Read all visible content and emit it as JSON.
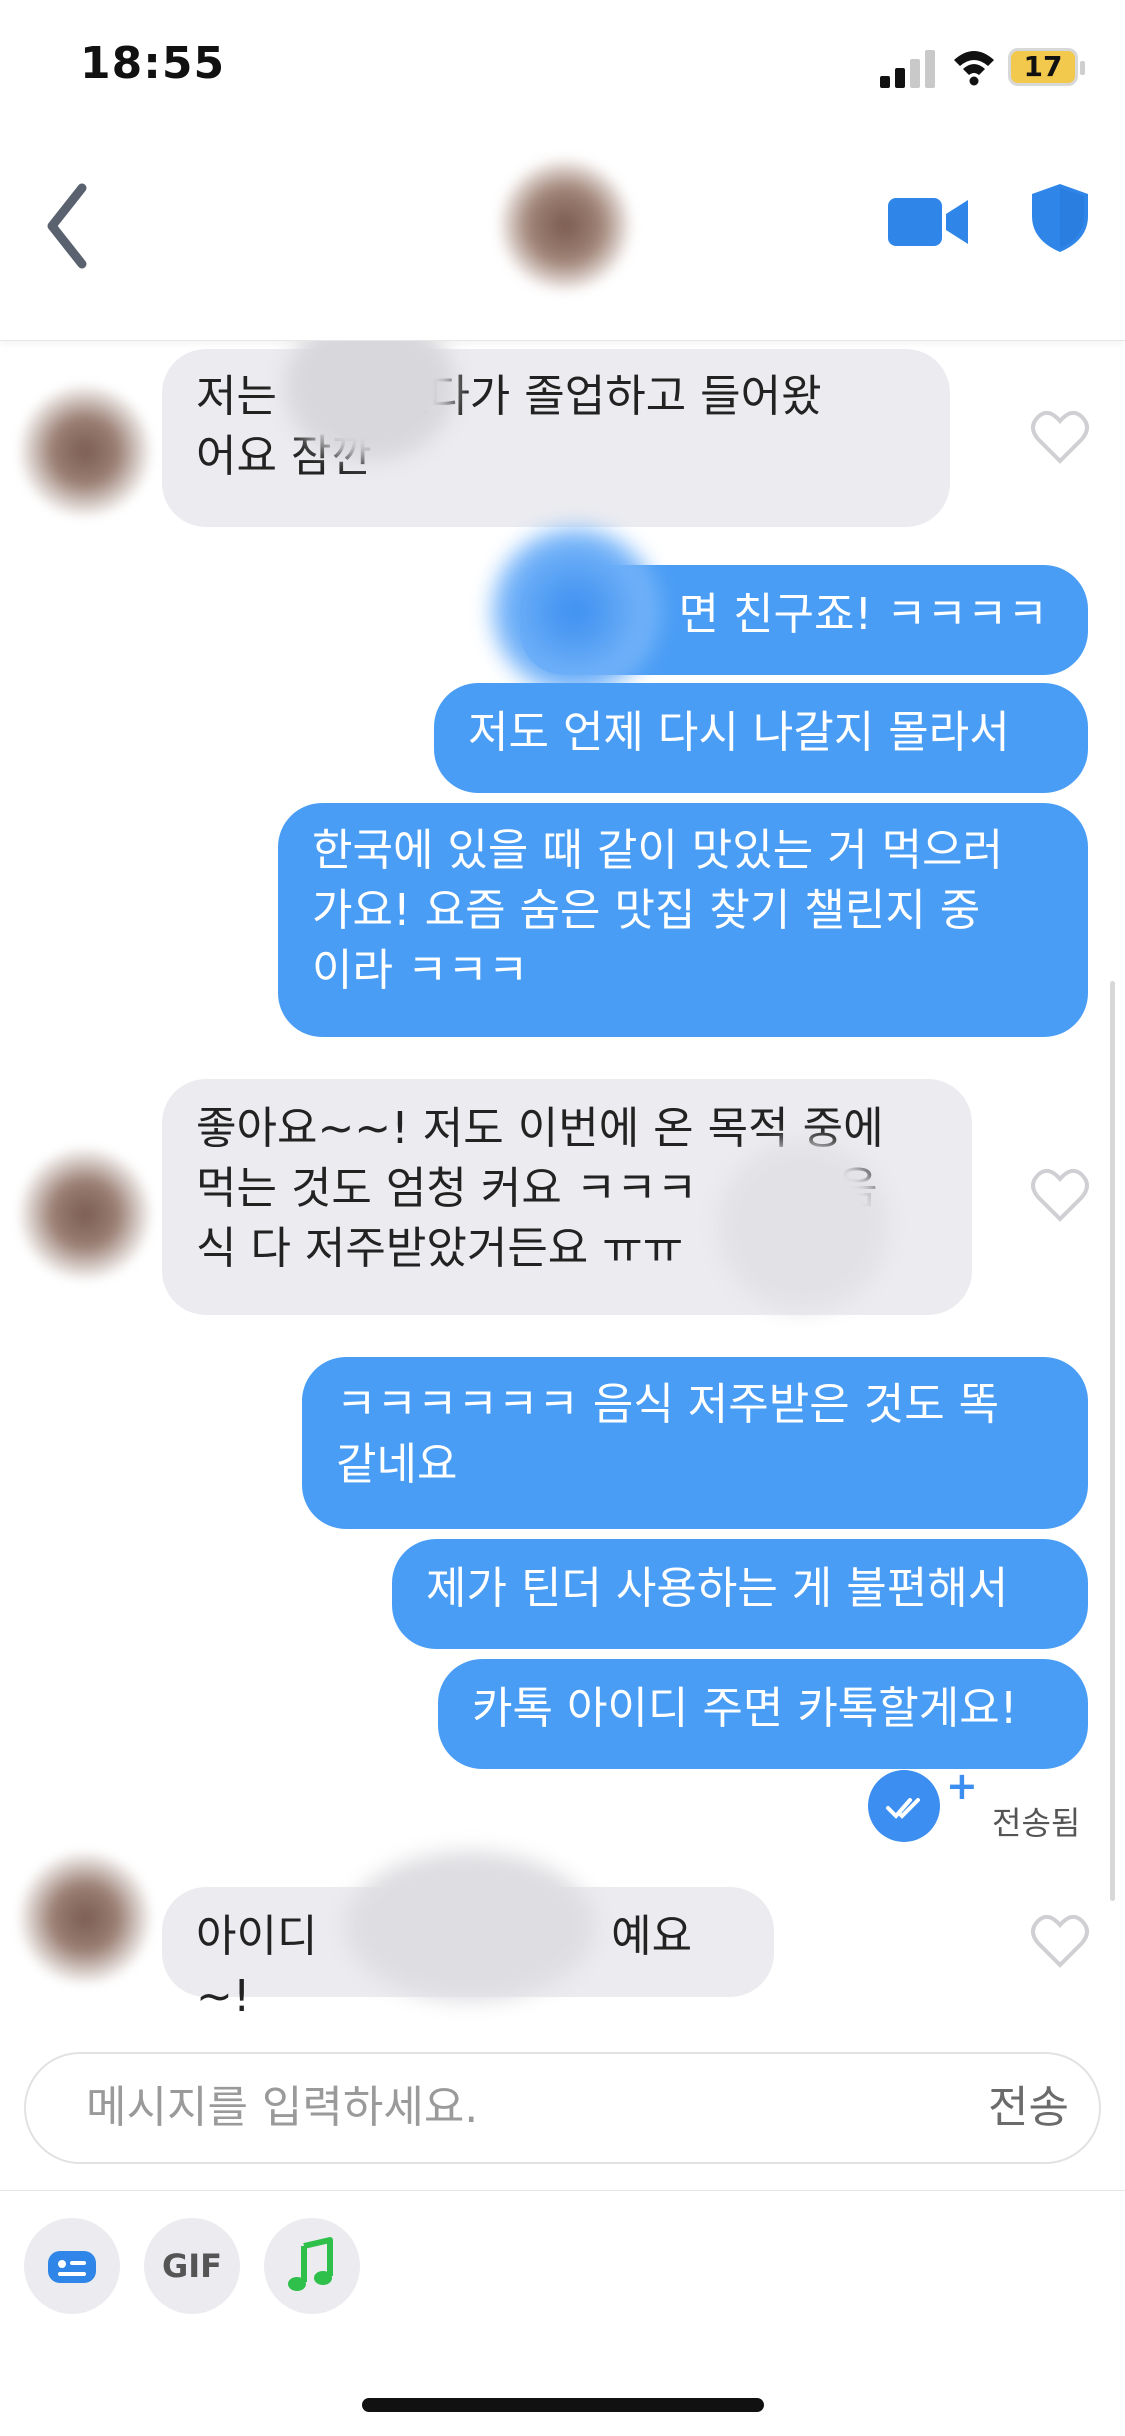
{
  "status_bar": {
    "time": "18:55",
    "battery": "17"
  },
  "chat": {
    "messages": [
      {
        "direction": "in",
        "text": "저는        있다가 졸업하고 들어왔\n어요 잠깐"
      },
      {
        "direction": "out",
        "text": "면 친구죠! ㅋㅋㅋㅋ"
      },
      {
        "direction": "out",
        "text": "저도 언제 다시 나갈지 몰라서"
      },
      {
        "direction": "out",
        "text": "한국에 있을 때 같이 맛있는 거 먹으러\n가요! 요즘 숨은 맛집 찾기 챌린지 중\n이라 ㅋㅋㅋ"
      },
      {
        "direction": "in",
        "text": "좋아요~~! 저도 이번에 온 목적 중에\n먹는 것도 엄청 커요 ㅋㅋㅋ          음\n식 다 저주받았거든요 ㅠㅠ"
      },
      {
        "direction": "out",
        "text": "ㅋㅋㅋㅋㅋㅋ 음식 저주받은 것도 똑\n같네요"
      },
      {
        "direction": "out",
        "text": "제가 틴더 사용하는 게 불편해서"
      },
      {
        "direction": "out",
        "text": "카톡 아이디 주면 카톡할게요!"
      },
      {
        "direction": "in",
        "text": "아이디                     예요~!"
      }
    ],
    "sent_status": "전송됨"
  },
  "composer": {
    "placeholder": "메시지를 입력하세요.",
    "send_label": "전송",
    "gif_label": "GIF"
  },
  "colors": {
    "accent": "#4a9df5",
    "incoming_bubble": "#ececf0",
    "music": "#2fbf4b"
  },
  "icons": [
    "back-chevron-icon",
    "video-call-icon",
    "shield-icon",
    "heart-icon",
    "double-check-icon",
    "sticker-icon",
    "music-note-icon"
  ]
}
